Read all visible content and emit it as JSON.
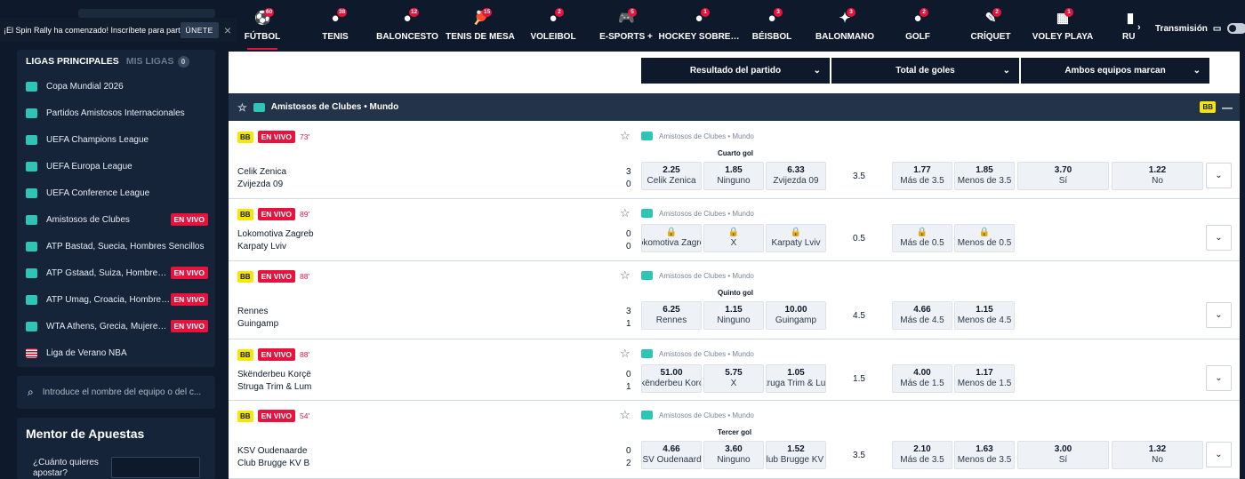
{
  "promo": {
    "text": "¡El Spin Rally ha comenzado! Inscríbete para participar",
    "join_label": "ÚNETE",
    "close": "×"
  },
  "leagues": {
    "tab_main": "LIGAS PRINCIPALES",
    "tab_mine": "MIS LIGAS",
    "tab_mine_count": "0",
    "items": [
      {
        "label": "Copa Mundial 2026",
        "live": ""
      },
      {
        "label": "Partidos Amistosos Internacionales",
        "live": ""
      },
      {
        "label": "UEFA Champions League",
        "live": ""
      },
      {
        "label": "UEFA Europa League",
        "live": ""
      },
      {
        "label": "UEFA Conference League",
        "live": ""
      },
      {
        "label": "Amistosos de Clubes",
        "live": "EN VIVO"
      },
      {
        "label": "ATP Bastad, Suecia, Hombres Sencillos",
        "live": ""
      },
      {
        "label": "ATP Gstaad, Suiza, Hombres Sencillos",
        "live": "EN VIVO"
      },
      {
        "label": "ATP Umag, Croacia, Hombres Sencillos",
        "live": "EN VIVO"
      },
      {
        "label": "WTA Athens, Grecia, Mujeres Sencillos",
        "live": "EN VIVO"
      },
      {
        "label": "Liga de Verano NBA",
        "live": ""
      }
    ]
  },
  "search": {
    "placeholder": "Introduce el nombre del equipo o del c..."
  },
  "mentor": {
    "title": "Mentor de Apuestas",
    "question": "¿Cuánto quieres apostar?"
  },
  "sports": [
    {
      "label": "FÚTBOL",
      "count": "60",
      "icon": "soccer-ball-icon",
      "glyph": "⚽"
    },
    {
      "label": "TENIS",
      "count": "38",
      "icon": "tennis-ball-icon",
      "glyph": "●"
    },
    {
      "label": "BALONCESTO",
      "count": "12",
      "icon": "basketball-icon",
      "glyph": "●"
    },
    {
      "label": "TENIS DE MESA",
      "count": "15",
      "icon": "table-tennis-icon",
      "glyph": "🏓"
    },
    {
      "label": "VOLEIBOL",
      "count": "2",
      "icon": "volleyball-icon",
      "glyph": "●"
    },
    {
      "label": "E-SPORTS +",
      "count": "5",
      "icon": "gamepad-icon",
      "glyph": "🎮"
    },
    {
      "label": "HOCKEY SOBRE…",
      "count": "1",
      "icon": "hockey-icon",
      "glyph": "●"
    },
    {
      "label": "BÉISBOL",
      "count": "3",
      "icon": "baseball-icon",
      "glyph": "●"
    },
    {
      "label": "BALONMANO",
      "count": "3",
      "icon": "handball-icon",
      "glyph": "✦"
    },
    {
      "label": "GOLF",
      "count": "2",
      "icon": "golf-icon",
      "glyph": "●"
    },
    {
      "label": "CRÍQUET",
      "count": "2",
      "icon": "cricket-icon",
      "glyph": "✎"
    },
    {
      "label": "VOLEY PLAYA",
      "count": "1",
      "icon": "beach-volley-icon",
      "glyph": "▦"
    },
    {
      "label": "RU",
      "count": "",
      "icon": "rugby-icon",
      "glyph": "▮"
    }
  ],
  "streaming": {
    "label": "Transmisión"
  },
  "markets": [
    "Resultado del partido",
    "Total de goles",
    "Ambos equipos marcan"
  ],
  "group": {
    "title": "Amistosos de Clubes • Mundo",
    "bb": "BB"
  },
  "matches": [
    {
      "bb": "BB",
      "live": "EN VIVO",
      "minute": "73'",
      "comp": "Amistosos de Clubes • Mundo",
      "sub": "Cuarto gol",
      "home": "Celik Zenica",
      "away": "Zvijezda 09",
      "score_home": "3",
      "score_away": "0",
      "odds": [
        {
          "v": "2.25",
          "l": "Celik Zenica"
        },
        {
          "v": "1.85",
          "l": "Ninguno"
        },
        {
          "v": "6.33",
          "l": "Zvijezda 09"
        }
      ],
      "line": "3.5",
      "totals": [
        {
          "v": "1.77",
          "l": "Más de 3.5"
        },
        {
          "v": "1.85",
          "l": "Menos de 3.5"
        }
      ],
      "btts": [
        {
          "v": "3.70",
          "l": "Sí"
        },
        {
          "v": "1.22",
          "l": "No"
        }
      ]
    },
    {
      "bb": "BB",
      "live": "EN VIVO",
      "minute": "89'",
      "comp": "Amistosos de Clubes • Mundo",
      "sub": "",
      "home": "Lokomotiva Zagreb",
      "away": "Karpaty Lviv",
      "score_home": "0",
      "score_away": "0",
      "odds": [
        {
          "v": "🔒",
          "l": "Lokomotiva Zagreb"
        },
        {
          "v": "🔒",
          "l": "X"
        },
        {
          "v": "🔒",
          "l": "Karpaty Lviv"
        }
      ],
      "line": "0.5",
      "totals": [
        {
          "v": "🔒",
          "l": "Más de 0.5"
        },
        {
          "v": "🔒",
          "l": "Menos de 0.5"
        }
      ],
      "btts": []
    },
    {
      "bb": "BB",
      "live": "EN VIVO",
      "minute": "88'",
      "comp": "Amistosos de Clubes • Mundo",
      "sub": "Quinto gol",
      "home": "Rennes",
      "away": "Guingamp",
      "score_home": "3",
      "score_away": "1",
      "odds": [
        {
          "v": "6.25",
          "l": "Rennes"
        },
        {
          "v": "1.15",
          "l": "Ninguno"
        },
        {
          "v": "10.00",
          "l": "Guingamp"
        }
      ],
      "line": "4.5",
      "totals": [
        {
          "v": "4.66",
          "l": "Más de 4.5"
        },
        {
          "v": "1.15",
          "l": "Menos de 4.5"
        }
      ],
      "btts": []
    },
    {
      "bb": "BB",
      "live": "EN VIVO",
      "minute": "88'",
      "comp": "Amistosos de Clubes • Mundo",
      "sub": "",
      "home": "Skënderbeu Korçë",
      "away": "Struga Trim & Lum",
      "score_home": "0",
      "score_away": "1",
      "odds": [
        {
          "v": "51.00",
          "l": "Skënderbeu Korçë"
        },
        {
          "v": "5.75",
          "l": "X"
        },
        {
          "v": "1.05",
          "l": "Struga Trim & Lum"
        }
      ],
      "line": "1.5",
      "totals": [
        {
          "v": "4.00",
          "l": "Más de 1.5"
        },
        {
          "v": "1.17",
          "l": "Menos de 1.5"
        }
      ],
      "btts": []
    },
    {
      "bb": "BB",
      "live": "EN VIVO",
      "minute": "54'",
      "comp": "Amistosos de Clubes • Mundo",
      "sub": "Tercer gol",
      "home": "KSV Oudenaarde",
      "away": "Club Brugge KV B",
      "score_home": "0",
      "score_away": "2",
      "odds": [
        {
          "v": "4.66",
          "l": "KSV Oudenaarde"
        },
        {
          "v": "3.60",
          "l": "Ninguno"
        },
        {
          "v": "1.52",
          "l": "Club Brugge KV B"
        }
      ],
      "line": "3.5",
      "totals": [
        {
          "v": "2.10",
          "l": "Más de 3.5"
        },
        {
          "v": "1.63",
          "l": "Menos de 3.5"
        }
      ],
      "btts": [
        {
          "v": "3.00",
          "l": "Sí"
        },
        {
          "v": "1.32",
          "l": "No"
        }
      ]
    }
  ]
}
